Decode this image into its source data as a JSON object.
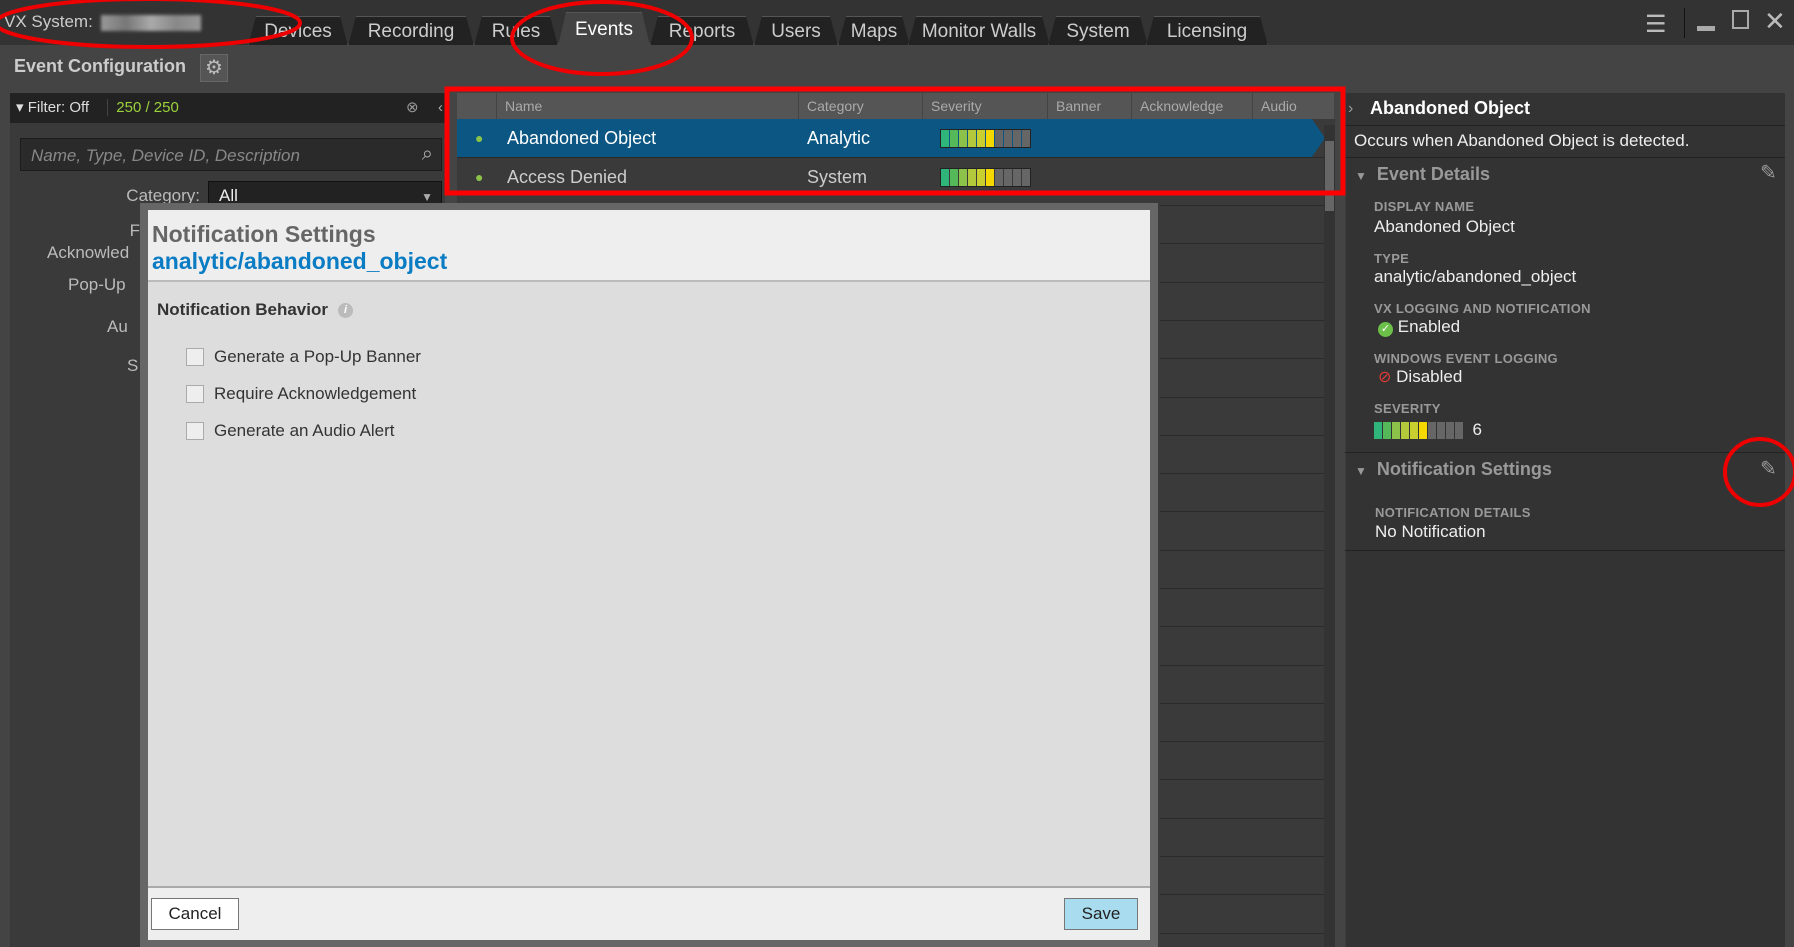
{
  "topbar": {
    "system_label": "VX System:",
    "tabs": [
      "Devices",
      "Recording",
      "Rules",
      "Events",
      "Reports",
      "Users",
      "Maps",
      "Monitor Walls",
      "System",
      "Licensing"
    ],
    "active_tab": "Events"
  },
  "left": {
    "title": "Event Configuration",
    "filter_label": "Filter: Off",
    "count": "250 / 250",
    "search_placeholder": "Name, Type, Device ID, Description",
    "category_label": "Category:",
    "category_value": "All",
    "partial_labels": [
      "F",
      "Acknowled",
      "Pop-Up",
      "Au",
      "S"
    ]
  },
  "table": {
    "columns": [
      "Name",
      "Category",
      "Severity",
      "Banner",
      "Acknowledge",
      "Audio"
    ],
    "rows": [
      {
        "name": "Abandoned Object",
        "category": "Analytic",
        "severity": 6,
        "selected": true
      },
      {
        "name": "Access Denied",
        "category": "System",
        "severity": 6,
        "selected": false
      }
    ]
  },
  "severity_colors": [
    "#2fb57a",
    "#55b95a",
    "#8dc24a",
    "#b3c93b",
    "#c8cf2e",
    "#f5d800"
  ],
  "details": {
    "title": "Abandoned Object",
    "description": "Occurs when Abandoned Object is detected.",
    "event_details_header": "Event Details",
    "display_name_label": "DISPLAY NAME",
    "display_name": "Abandoned Object",
    "type_label": "TYPE",
    "type": "analytic/abandoned_object",
    "vx_logging_label": "VX LOGGING AND NOTIFICATION",
    "vx_logging": "Enabled",
    "windows_logging_label": "WINDOWS EVENT LOGGING",
    "windows_logging": "Disabled",
    "severity_label": "SEVERITY",
    "severity": "6",
    "notification_header": "Notification Settings",
    "notification_details_label": "NOTIFICATION DETAILS",
    "notification_details": "No Notification"
  },
  "modal": {
    "title": "Notification Settings",
    "subtitle": "analytic/abandoned_object",
    "section": "Notification Behavior",
    "options": [
      {
        "label": "Generate a Pop-Up Banner",
        "checked": false
      },
      {
        "label": "Require Acknowledgement",
        "checked": false
      },
      {
        "label": "Generate an Audio Alert",
        "checked": false
      }
    ],
    "cancel": "Cancel",
    "save": "Save"
  }
}
